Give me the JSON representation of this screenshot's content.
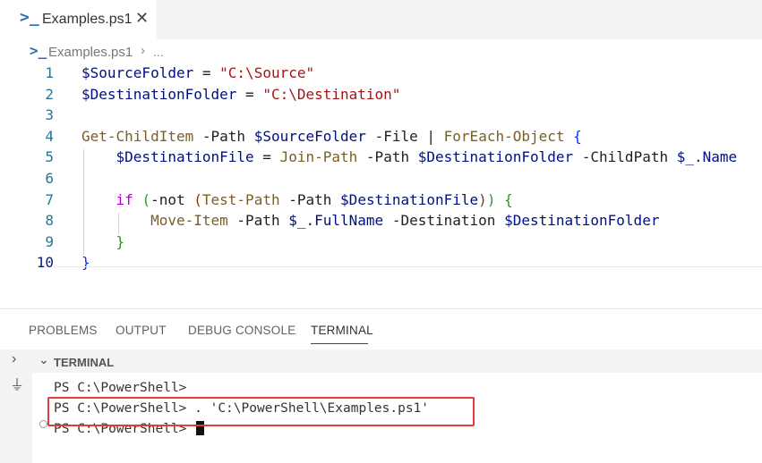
{
  "tab": {
    "label": "Examples.ps1",
    "icon": "powershell-icon",
    "close": "✕"
  },
  "breadcrumb": {
    "file": "Examples.ps1",
    "separator": "›",
    "more": "..."
  },
  "editor": {
    "line_numbers": [
      "1",
      "2",
      "3",
      "4",
      "5",
      "6",
      "7",
      "8",
      "9",
      "10"
    ]
  },
  "panel": {
    "tabs": [
      "PROBLEMS",
      "OUTPUT",
      "DEBUG CONSOLE",
      "TERMINAL"
    ],
    "active_tab": "TERMINAL",
    "terminal_title": "TERMINAL",
    "lines": [
      "PS C:\\PowerShell>",
      "PS C:\\PowerShell> . 'C:\\PowerShell\\Examples.ps1'",
      "PS C:\\PowerShell>"
    ]
  },
  "colors": {
    "highlight_box": "#e03c3c",
    "accent": "#2a6db5"
  }
}
